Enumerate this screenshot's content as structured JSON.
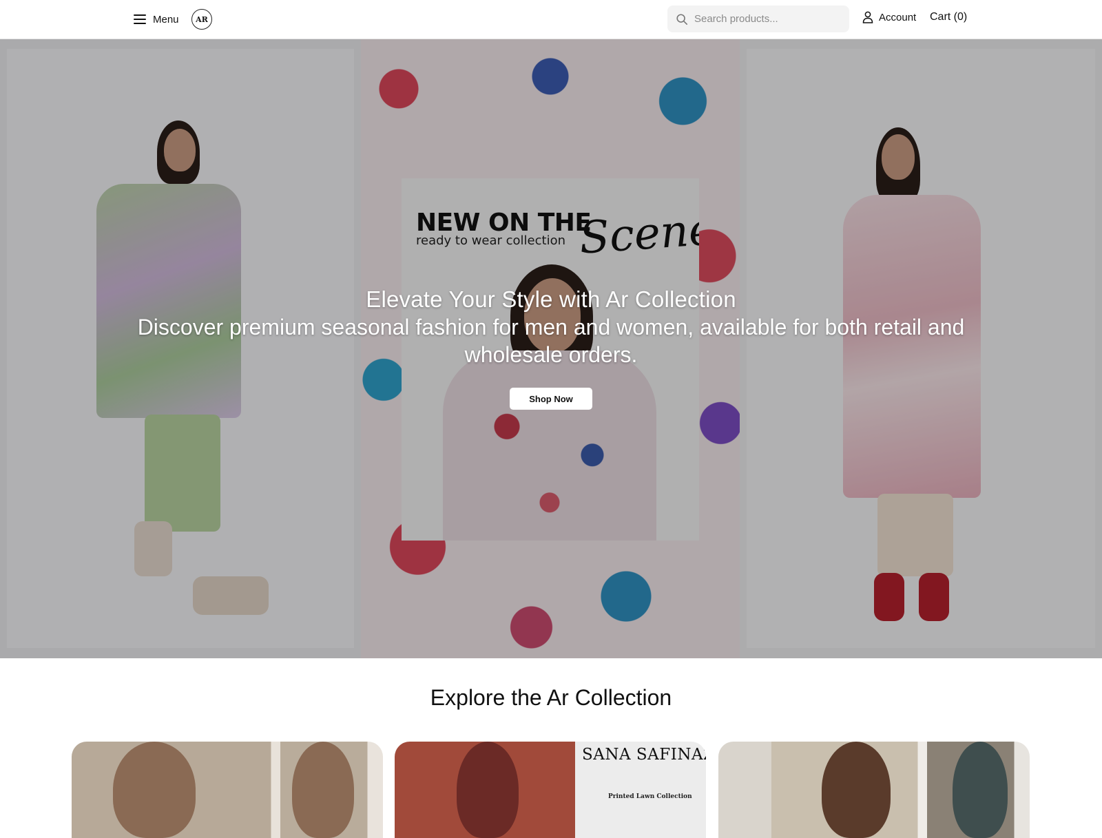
{
  "header": {
    "menu_label": "Menu",
    "logo_text": "AR",
    "search_placeholder": "Search products...",
    "account_label": "Account",
    "cart_label": "Cart (0)"
  },
  "hero": {
    "poster_title": "NEW ON THE",
    "poster_subtitle": "ready to wear collection",
    "poster_script": "Scene",
    "title": "Elevate Your Style with Ar Collection",
    "subtitle": "Discover premium seasonal fashion for men and women, available for both retail and wholesale orders.",
    "cta_label": "Shop Now"
  },
  "collection": {
    "title": "Explore the Ar Collection",
    "cards": [
      {
        "brand": "",
        "tag": ""
      },
      {
        "brand": "SANA SAFINAZ",
        "tag": "Printed Lawn Collection"
      },
      {
        "brand": "",
        "tag": ""
      }
    ]
  },
  "colors": {
    "overlay": "#000000",
    "header_bg": "#ffffff",
    "search_bg": "#f3f3f3"
  },
  "icons": [
    "hamburger-icon",
    "search-icon",
    "user-icon"
  ]
}
